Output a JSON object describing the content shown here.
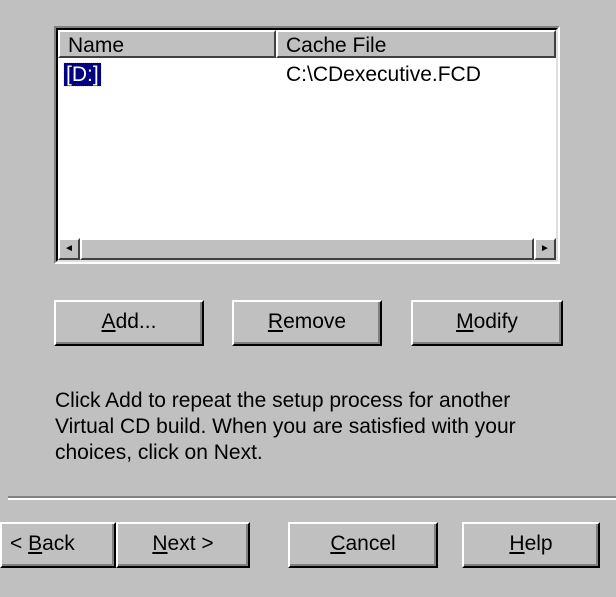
{
  "list": {
    "columns": [
      "Name",
      "Cache File"
    ],
    "rows": [
      {
        "name": "[D:]",
        "cache_file": "C:\\CDexecutive.FCD",
        "selected": true
      }
    ]
  },
  "scrollbar": {
    "left_arrow": "◄",
    "right_arrow": "►"
  },
  "buttons": {
    "add": {
      "mnemonic": "A",
      "rest": "dd..."
    },
    "remove": {
      "mnemonic": "R",
      "rest": "emove"
    },
    "modify": {
      "mnemonic": "M",
      "rest": "odify"
    }
  },
  "instructions": "Click Add to repeat the setup process for another Virtual CD build. When you are satisfied with your choices, click on Next.",
  "nav": {
    "back": {
      "prefix": "< ",
      "mnemonic": "B",
      "rest": "ack"
    },
    "next": {
      "mnemonic": "N",
      "rest": "ext >"
    },
    "cancel": {
      "mnemonic": "C",
      "rest": "ancel"
    },
    "help": {
      "mnemonic": "H",
      "rest": "elp"
    }
  }
}
